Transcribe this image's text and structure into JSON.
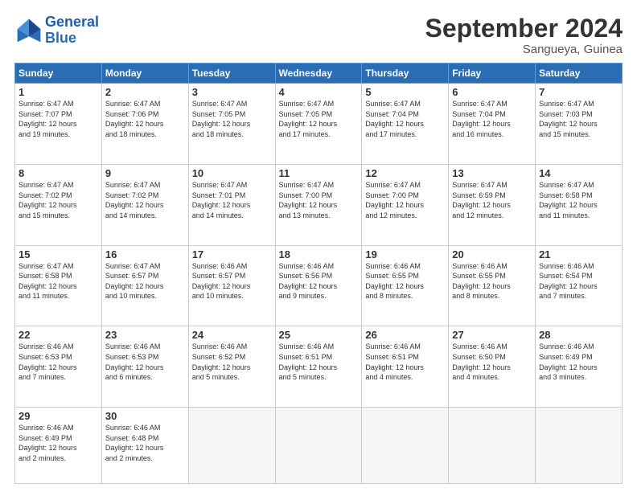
{
  "header": {
    "logo_line1": "General",
    "logo_line2": "Blue",
    "month_title": "September 2024",
    "location": "Sangueya, Guinea"
  },
  "weekdays": [
    "Sunday",
    "Monday",
    "Tuesday",
    "Wednesday",
    "Thursday",
    "Friday",
    "Saturday"
  ],
  "weeks": [
    [
      {
        "day": "1",
        "info": "Sunrise: 6:47 AM\nSunset: 7:07 PM\nDaylight: 12 hours\nand 19 minutes."
      },
      {
        "day": "2",
        "info": "Sunrise: 6:47 AM\nSunset: 7:06 PM\nDaylight: 12 hours\nand 18 minutes."
      },
      {
        "day": "3",
        "info": "Sunrise: 6:47 AM\nSunset: 7:05 PM\nDaylight: 12 hours\nand 18 minutes."
      },
      {
        "day": "4",
        "info": "Sunrise: 6:47 AM\nSunset: 7:05 PM\nDaylight: 12 hours\nand 17 minutes."
      },
      {
        "day": "5",
        "info": "Sunrise: 6:47 AM\nSunset: 7:04 PM\nDaylight: 12 hours\nand 17 minutes."
      },
      {
        "day": "6",
        "info": "Sunrise: 6:47 AM\nSunset: 7:04 PM\nDaylight: 12 hours\nand 16 minutes."
      },
      {
        "day": "7",
        "info": "Sunrise: 6:47 AM\nSunset: 7:03 PM\nDaylight: 12 hours\nand 15 minutes."
      }
    ],
    [
      {
        "day": "8",
        "info": "Sunrise: 6:47 AM\nSunset: 7:02 PM\nDaylight: 12 hours\nand 15 minutes."
      },
      {
        "day": "9",
        "info": "Sunrise: 6:47 AM\nSunset: 7:02 PM\nDaylight: 12 hours\nand 14 minutes."
      },
      {
        "day": "10",
        "info": "Sunrise: 6:47 AM\nSunset: 7:01 PM\nDaylight: 12 hours\nand 14 minutes."
      },
      {
        "day": "11",
        "info": "Sunrise: 6:47 AM\nSunset: 7:00 PM\nDaylight: 12 hours\nand 13 minutes."
      },
      {
        "day": "12",
        "info": "Sunrise: 6:47 AM\nSunset: 7:00 PM\nDaylight: 12 hours\nand 12 minutes."
      },
      {
        "day": "13",
        "info": "Sunrise: 6:47 AM\nSunset: 6:59 PM\nDaylight: 12 hours\nand 12 minutes."
      },
      {
        "day": "14",
        "info": "Sunrise: 6:47 AM\nSunset: 6:58 PM\nDaylight: 12 hours\nand 11 minutes."
      }
    ],
    [
      {
        "day": "15",
        "info": "Sunrise: 6:47 AM\nSunset: 6:58 PM\nDaylight: 12 hours\nand 11 minutes."
      },
      {
        "day": "16",
        "info": "Sunrise: 6:47 AM\nSunset: 6:57 PM\nDaylight: 12 hours\nand 10 minutes."
      },
      {
        "day": "17",
        "info": "Sunrise: 6:46 AM\nSunset: 6:57 PM\nDaylight: 12 hours\nand 10 minutes."
      },
      {
        "day": "18",
        "info": "Sunrise: 6:46 AM\nSunset: 6:56 PM\nDaylight: 12 hours\nand 9 minutes."
      },
      {
        "day": "19",
        "info": "Sunrise: 6:46 AM\nSunset: 6:55 PM\nDaylight: 12 hours\nand 8 minutes."
      },
      {
        "day": "20",
        "info": "Sunrise: 6:46 AM\nSunset: 6:55 PM\nDaylight: 12 hours\nand 8 minutes."
      },
      {
        "day": "21",
        "info": "Sunrise: 6:46 AM\nSunset: 6:54 PM\nDaylight: 12 hours\nand 7 minutes."
      }
    ],
    [
      {
        "day": "22",
        "info": "Sunrise: 6:46 AM\nSunset: 6:53 PM\nDaylight: 12 hours\nand 7 minutes."
      },
      {
        "day": "23",
        "info": "Sunrise: 6:46 AM\nSunset: 6:53 PM\nDaylight: 12 hours\nand 6 minutes."
      },
      {
        "day": "24",
        "info": "Sunrise: 6:46 AM\nSunset: 6:52 PM\nDaylight: 12 hours\nand 5 minutes."
      },
      {
        "day": "25",
        "info": "Sunrise: 6:46 AM\nSunset: 6:51 PM\nDaylight: 12 hours\nand 5 minutes."
      },
      {
        "day": "26",
        "info": "Sunrise: 6:46 AM\nSunset: 6:51 PM\nDaylight: 12 hours\nand 4 minutes."
      },
      {
        "day": "27",
        "info": "Sunrise: 6:46 AM\nSunset: 6:50 PM\nDaylight: 12 hours\nand 4 minutes."
      },
      {
        "day": "28",
        "info": "Sunrise: 6:46 AM\nSunset: 6:49 PM\nDaylight: 12 hours\nand 3 minutes."
      }
    ],
    [
      {
        "day": "29",
        "info": "Sunrise: 6:46 AM\nSunset: 6:49 PM\nDaylight: 12 hours\nand 2 minutes."
      },
      {
        "day": "30",
        "info": "Sunrise: 6:46 AM\nSunset: 6:48 PM\nDaylight: 12 hours\nand 2 minutes."
      },
      {
        "day": "",
        "info": ""
      },
      {
        "day": "",
        "info": ""
      },
      {
        "day": "",
        "info": ""
      },
      {
        "day": "",
        "info": ""
      },
      {
        "day": "",
        "info": ""
      }
    ]
  ]
}
